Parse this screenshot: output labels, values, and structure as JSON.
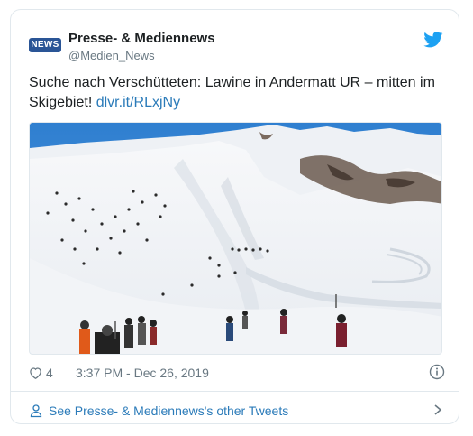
{
  "author": {
    "display_name": "Presse- & Mediennews",
    "handle": "@Medien_News",
    "avatar_text": "NEWS"
  },
  "tweet": {
    "text": "Suche nach Verschütteten: Lawine in Andermatt UR – mitten im Skigebiet!",
    "link": "dlvr.it/RLxjNy"
  },
  "media": {
    "icon": "photo-icon"
  },
  "meta": {
    "likes": "4",
    "timestamp": "3:37 PM - Dec 26, 2019"
  },
  "footer": {
    "other_tweets_label": "See Presse- & Mediennews's other Tweets"
  },
  "colors": {
    "link": "#2b7bb9",
    "twitter_blue": "#1da1f2",
    "avatar_bg": "#2a5596"
  }
}
